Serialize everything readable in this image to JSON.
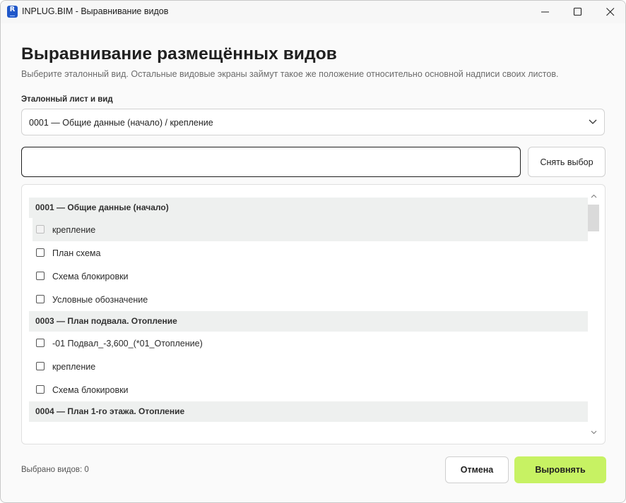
{
  "window": {
    "title": "INPLUG.BIM - Выравнивание видов",
    "app_icon_letter": "R"
  },
  "header": {
    "title": "Выравнивание размещённых видов",
    "subtitle": "Выберите эталонный вид. Остальные видовые экраны займут такое же положение относительно основной надписи своих листов."
  },
  "reference": {
    "label": "Эталонный лист и вид",
    "selected": "0001 — Общие данные (начало) / крепление"
  },
  "search": {
    "value": "",
    "placeholder": ""
  },
  "clear_button": "Снять выбор",
  "list": {
    "groups": [
      {
        "title": "0001 — Общие данные (начало)",
        "items": [
          {
            "label": "крепление",
            "checked": false,
            "disabled": true
          },
          {
            "label": "План схема",
            "checked": false
          },
          {
            "label": "Схема блокировки",
            "checked": false
          },
          {
            "label": "Условные обозначение",
            "checked": false
          }
        ]
      },
      {
        "title": "0003 — План подвала. Отопление",
        "items": [
          {
            "label": "-01 Подвал_-3,600_(*01_Отопление)",
            "checked": false
          },
          {
            "label": "крепление",
            "checked": false
          },
          {
            "label": "Схема блокировки",
            "checked": false
          }
        ]
      },
      {
        "title": "0004 — План 1-го этажа. Отопление",
        "items": []
      }
    ]
  },
  "footer": {
    "selected_count_text": "Выбрано видов: 0",
    "cancel_label": "Отмена",
    "align_label": "Выровнять"
  },
  "colors": {
    "accent": "#c7f263",
    "group_bg": "#eef0ef",
    "app_icon": "#1f57c9"
  }
}
